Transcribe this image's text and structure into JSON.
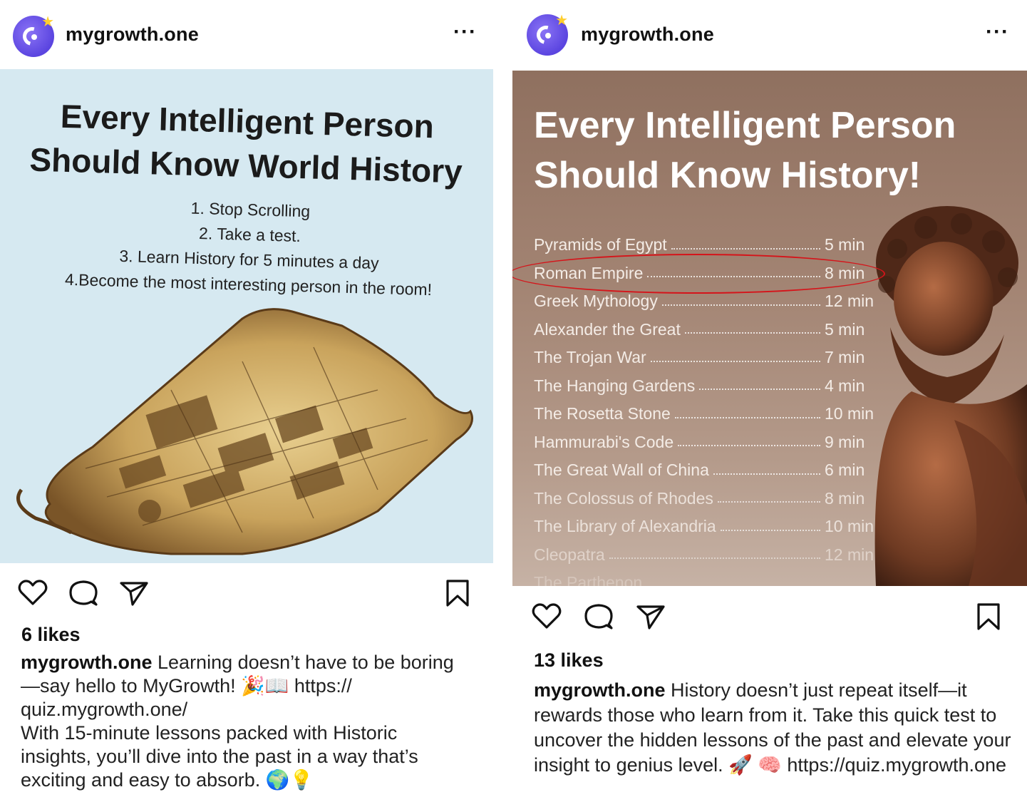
{
  "posts": [
    {
      "username": "mygrowth.one",
      "more": "···",
      "image": {
        "title_line1": "Every Intelligent Person",
        "title_line2": "Should Know World History",
        "steps": [
          "1. Stop Scrolling",
          "2. Take a test.",
          "3. Learn History for 5 minutes a day",
          "4.Become the most interesting person in the room!"
        ]
      },
      "likes": "6 likes",
      "caption_user": "mygrowth.one",
      "caption_p1": " Learning doesn’t have to be boring—say hello to MyGrowth! 🎉📖 https:// quiz.mygrowth.one/",
      "caption_p2": "With 15-minute lessons packed with Historic insights, you’ll dive into the past in a way that’s exciting and easy to absorb. 🌍💡"
    },
    {
      "username": "mygrowth.one",
      "more": "···",
      "image": {
        "title_line1": "Every Intelligent Person",
        "title_line2": "Should Know History!",
        "topics": [
          {
            "name": "Pyramids of Egypt",
            "time": "5 min"
          },
          {
            "name": "Roman Empire",
            "time": "8 min"
          },
          {
            "name": "Greek Mythology",
            "time": "12 min"
          },
          {
            "name": "Alexander the Great",
            "time": "5 min"
          },
          {
            "name": "The Trojan War",
            "time": "7 min"
          },
          {
            "name": "The Hanging Gardens",
            "time": "4 min"
          },
          {
            "name": "The Rosetta Stone",
            "time": "10 min"
          },
          {
            "name": "Hammurabi's Code",
            "time": "9 min"
          },
          {
            "name": "The Great Wall of China",
            "time": "6 min"
          },
          {
            "name": "The Colossus of Rhodes",
            "time": "8 min"
          },
          {
            "name": "The Library of Alexandria",
            "time": "10 min"
          },
          {
            "name": "Cleopatra",
            "time": "12 min"
          },
          {
            "name": "The Parthenon",
            "time": ""
          }
        ],
        "highlighted_topic": "Roman Empire",
        "highlight_color": "#d5141a"
      },
      "likes": "13 likes",
      "caption_user": "mygrowth.one",
      "caption_p1": " History doesn’t just repeat itself—it rewards those who learn from it. Take this quick test to uncover the hidden lessons of the past and elevate your insight to genius level. 🚀 🧠 https://quiz.mygrowth.one"
    }
  ],
  "colors": {
    "avatar": "#6a55ea",
    "left_bg": "#d6e9f1",
    "right_bg": "#a28372"
  },
  "icons": [
    "heart-icon",
    "comment-icon",
    "share-icon",
    "bookmark-icon",
    "more-icon"
  ]
}
